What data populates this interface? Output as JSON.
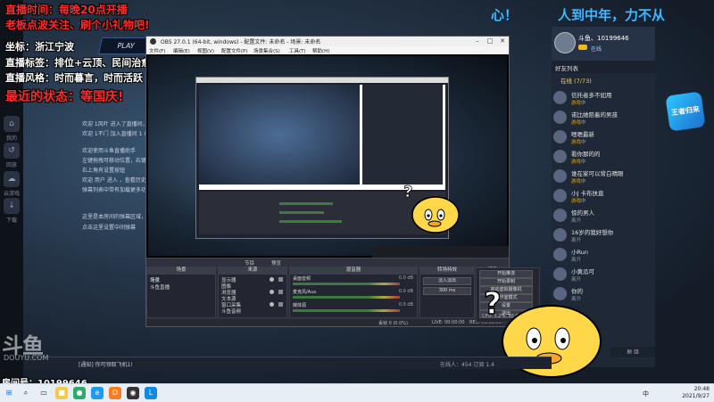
{
  "overlay": {
    "schedule": "直播时间：每晚20点开播",
    "promo": "老板点波关注、刷个小礼物吧!",
    "location": "坐标：浙江宁波",
    "tags": "直播标签：排位+云顶、民间治愈歌手",
    "style": "直播风格：时而暮言，时而活跃",
    "recent": "最近的状态：等国庆!",
    "play_label": "PLAY"
  },
  "ticker": {
    "left": "心！",
    "right": "人到中年，力不从"
  },
  "left_strip": {
    "items": [
      {
        "label": "我的",
        "icon": "home-icon"
      },
      {
        "label": "回放",
        "icon": "replay-icon"
      },
      {
        "label": "云游戏",
        "icon": "cloud-icon"
      },
      {
        "label": "下载",
        "icon": "download-icon"
      }
    ]
  },
  "game_chat": {
    "lines": [
      "欢迎 1风叶 进入了直播间，当前用户进入直播间",
      "欢迎 1不门 加入直播间 1 以 进入直播间",
      "欢迎使用斗鱼直播助手",
      "左键拖拽可移动位置，右键菜单设置",
      "右上角有设置按钮",
      "欢迎 用户 进入 ，查看历史弹幕",
      "弹幕列表中带有加载更多功能",
      "这里是本房间的弹幕区域，请友善发言",
      "点击这里设置中间弹幕"
    ]
  },
  "obs": {
    "title": "OBS 27.0.1 (64-bit, windows) - 配置文件: 未命名 - 场景: 未命名",
    "menus": [
      "文件(F)",
      "编辑(E)",
      "视图(V)",
      "配置文件(P)",
      "场景集合(S)",
      "工具(T)",
      "帮助(H)"
    ],
    "dockbar": [
      "节目",
      "预览"
    ],
    "scenes_header": "场景",
    "sources_header": "来源",
    "mixer_header": "混音器",
    "transitions_header": "转场特效",
    "controls_header": "控件",
    "scenes": [
      "场景",
      "斗鱼直播"
    ],
    "sources": [
      "显示器",
      "图像",
      "浏览器",
      "文本源",
      "窗口采集",
      "斗鱼音频"
    ],
    "mixer": [
      {
        "name": "桌面音频",
        "db": "0.0 dB"
      },
      {
        "name": "麦克风/Aux",
        "db": "0.0 dB"
      },
      {
        "name": "媒体源",
        "db": "0.0 dB"
      }
    ],
    "transition_value": "淡入淡出",
    "transition_duration": "300 ms",
    "controls": [
      "开始推流",
      "开始录制",
      "启动虚拟摄像机",
      "工作室模式",
      "设置",
      "退出"
    ],
    "status": {
      "dropped": "丢帧 0 (0.0%)",
      "live": "LIVE: 00:00:00",
      "rec": "REC: 00:00:00",
      "cpu": "CPU: 5.2%, 30.00 fps"
    },
    "stats_label": "CPU 5.2%  30.00 fps"
  },
  "sidebar": {
    "streamer_name": "斗鱼、10199646",
    "streamer_status": "在线",
    "tab": "好友列表",
    "group": "在线 (7/73)",
    "friends": [
      {
        "name": "信托者多不如用",
        "status": "游戏中"
      },
      {
        "name": "诺比她陪着的男孩",
        "status": "游戏中"
      },
      {
        "name": "嗯嗯最新",
        "status": "游戏中"
      },
      {
        "name": "看你那的的",
        "status": "游戏中"
      },
      {
        "name": "谁在家可以背白晴眼",
        "status": "游戏中"
      },
      {
        "name": "小J 卡布扶直",
        "status": "游戏中"
      },
      {
        "name": "惊的男人",
        "status": "离开"
      },
      {
        "name": "16岁的我好想你",
        "status": "离开"
      },
      {
        "name": "小Run",
        "status": "离开"
      },
      {
        "name": "小黄瓜可",
        "status": "离开"
      },
      {
        "name": "你的",
        "status": "离开"
      }
    ],
    "bottom_label": "▤ ▥"
  },
  "vlog_badge": "王者归来",
  "watermark": {
    "logo": "斗鱼",
    "domain": "DOUYU.COM",
    "room": "房间号：10199646"
  },
  "chat_bar": {
    "message": "[通知] 你可领取飞机1!",
    "count": "在线人：454   订阅 1.4"
  },
  "taskbar": {
    "time": "20:48",
    "date": "2021/9/27",
    "lang": "中"
  }
}
